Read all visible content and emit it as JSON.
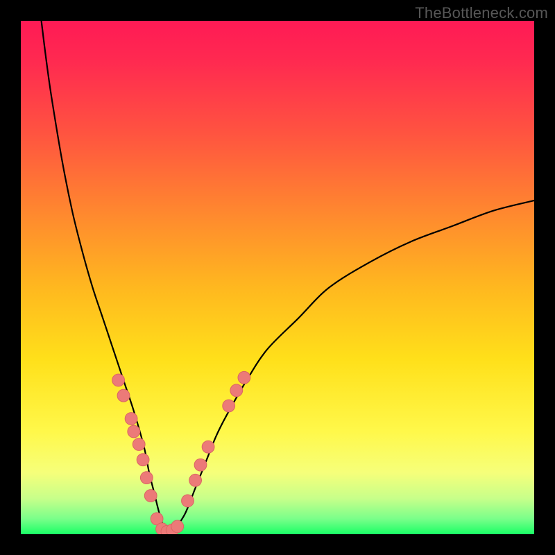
{
  "watermark": "TheBottleneck.com",
  "chart_data": {
    "type": "line",
    "title": "",
    "xlabel": "",
    "ylabel": "",
    "xlim": [
      0,
      100
    ],
    "ylim": [
      0,
      100
    ],
    "grid": false,
    "legend": false,
    "gradient_stops": [
      {
        "pct": 0,
        "color": "#ff1a55"
      },
      {
        "pct": 8,
        "color": "#ff2a50"
      },
      {
        "pct": 22,
        "color": "#ff5440"
      },
      {
        "pct": 38,
        "color": "#ff8a2e"
      },
      {
        "pct": 52,
        "color": "#ffb81f"
      },
      {
        "pct": 66,
        "color": "#ffe01a"
      },
      {
        "pct": 80,
        "color": "#fff84a"
      },
      {
        "pct": 88,
        "color": "#f6ff7a"
      },
      {
        "pct": 93,
        "color": "#c8ff8a"
      },
      {
        "pct": 97,
        "color": "#7aff8a"
      },
      {
        "pct": 100,
        "color": "#1aff66"
      }
    ],
    "series": [
      {
        "name": "bottleneck-curve",
        "x": [
          4,
          5,
          6,
          8,
          10,
          12,
          14,
          16,
          18,
          20,
          22,
          24,
          25,
          26,
          27,
          28,
          29,
          30,
          32,
          34,
          36,
          38,
          40,
          44,
          48,
          54,
          60,
          68,
          76,
          84,
          92,
          100
        ],
        "y": [
          100,
          92,
          85,
          73,
          63,
          55,
          48,
          42,
          36,
          30,
          24,
          17,
          12,
          8,
          4,
          1,
          0,
          1,
          4,
          9,
          14,
          19,
          23,
          30,
          36,
          42,
          48,
          53,
          57,
          60,
          63,
          65
        ]
      }
    ],
    "markers": [
      {
        "x": 19.0,
        "y": 30.0
      },
      {
        "x": 20.0,
        "y": 27.0
      },
      {
        "x": 21.5,
        "y": 22.5
      },
      {
        "x": 22.0,
        "y": 20.0
      },
      {
        "x": 23.0,
        "y": 17.5
      },
      {
        "x": 23.8,
        "y": 14.5
      },
      {
        "x": 24.5,
        "y": 11.0
      },
      {
        "x": 25.3,
        "y": 7.5
      },
      {
        "x": 26.5,
        "y": 3.0
      },
      {
        "x": 27.5,
        "y": 1.0
      },
      {
        "x": 28.5,
        "y": 0.5
      },
      {
        "x": 29.5,
        "y": 0.8
      },
      {
        "x": 30.5,
        "y": 1.5
      },
      {
        "x": 32.5,
        "y": 6.5
      },
      {
        "x": 34.0,
        "y": 10.5
      },
      {
        "x": 35.0,
        "y": 13.5
      },
      {
        "x": 36.5,
        "y": 17.0
      },
      {
        "x": 40.5,
        "y": 25.0
      },
      {
        "x": 42.0,
        "y": 28.0
      },
      {
        "x": 43.5,
        "y": 30.5
      }
    ],
    "marker_radius": 1.2
  }
}
